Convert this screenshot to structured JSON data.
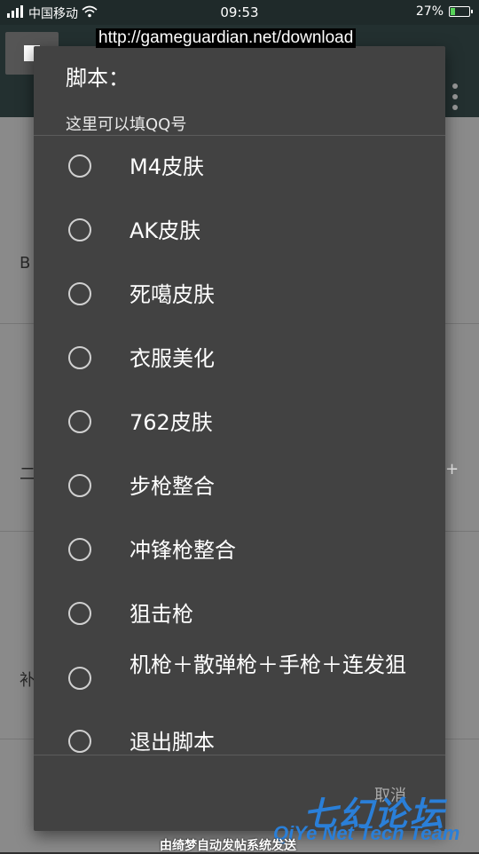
{
  "status_bar": {
    "carrier": "中国移动",
    "time": "09:53",
    "battery": "27%",
    "battery_level": 0.27
  },
  "overlay": {
    "url": "http://gameguardian.net/download"
  },
  "background": {
    "row_texts": [
      "B",
      "二",
      "补"
    ],
    "plus": "+"
  },
  "dialog": {
    "title": "脚本：",
    "subtitle": "这里可以填QQ号",
    "items": [
      {
        "label": "M4皮肤"
      },
      {
        "label": "AK皮肤"
      },
      {
        "label": "死噶皮肤"
      },
      {
        "label": "衣服美化"
      },
      {
        "label": "762皮肤"
      },
      {
        "label": "步枪整合"
      },
      {
        "label": "冲锋枪整合"
      },
      {
        "label": "狙击枪"
      },
      {
        "label": "机枪＋散弹枪＋手枪＋连发狙"
      },
      {
        "label": "退出脚本"
      }
    ],
    "cancel": "取消"
  },
  "watermark": {
    "cn": "七幻论坛",
    "en": "QiYe Net Tech Team",
    "bottom": "由绮梦自动发帖系统发送"
  }
}
